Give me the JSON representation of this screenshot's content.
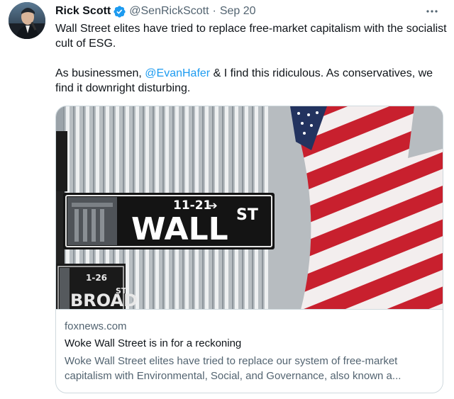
{
  "author": {
    "name": "Rick Scott",
    "handle": "@SenRickScott",
    "separator": "·",
    "date": "Sep 20"
  },
  "tweet": {
    "line1": "Wall Street elites have tried to replace free-market capitalism with the socialist cult of ESG.",
    "line2_prefix": "As businessmen, ",
    "line2_mention": "@EvanHafer",
    "line2_suffix": " & I find this ridiculous. As conservatives, we find it downright disturbing."
  },
  "card": {
    "domain": "foxnews.com",
    "title": "Woke Wall Street is in for a reckoning",
    "description": "Woke Wall Street elites have tried to replace our system of free-market capitalism with Environmental, Social, and Governance, also known a...",
    "image_sign": {
      "number": "11-21",
      "arrow": "➔",
      "street": "WALL",
      "suffix": "ST",
      "second_number": "1-26",
      "second_street": "BROAD",
      "second_suffix": "ST"
    }
  },
  "icons": {
    "verified": "verified-badge-icon",
    "more": "more-options-icon"
  },
  "colors": {
    "link": "#1d9bf0",
    "verified": "#1d9bf0",
    "secondary_text": "#536471",
    "primary_text": "#0f1419",
    "border": "#cfd9de"
  }
}
